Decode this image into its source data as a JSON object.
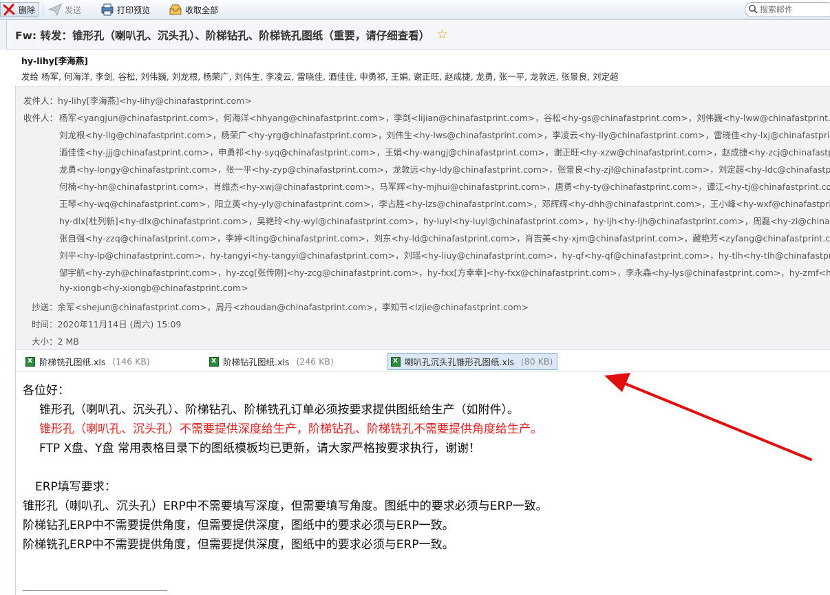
{
  "toolbar": {
    "delete_label": "删除",
    "send_label": "发送",
    "print_label": "打印预览",
    "receive_label": "收取全部",
    "search_placeholder": "搜索邮件"
  },
  "email": {
    "subject": "Fw: 转发：锥形孔（喇叭孔、沉头孔）、阶梯钻孔、阶梯铣孔图纸（重要，请仔细查看）",
    "from_name": "hy-lihy[李海燕]",
    "sendto_line": "发给 杨军, 何海洋, 李剑, 谷松, 刘伟巍, 刘龙根, 杨荣广, 刘伟生, 李凌云, 雷晓佳, 酒佳佳, 申勇祁, 王娟, 谢正旺, 赵成捷, 龙勇, 张一平, 龙敦远, 张景良, 刘定超",
    "sender_label": "发件人：",
    "sender_value": "hy-lihy[李海燕]<hy-lihy@chinafastprint.com>",
    "recipients_label": "收件人：",
    "recipients_lines": [
      "杨军<yangjun@chinafastprint.com>，何海洋<hhyang@chinafastprint.com>，李剑<lijian@chinafastprint.com>，谷松<hy-gs@chinafastprint.com>，刘伟巍<hy-lww@chinafastprint.co",
      "刘龙根<hy-llg@chinafastprint.com>，杨荣广<hy-yrg@chinafastprint.com>，刘伟生<hy-lws@chinafastprint.com>，李凌云<hy-lly@chinafastprint.com>，雷晓佳<hy-lxj@chinafastprint",
      "酒佳佳<hy-jjj@chinafastprint.com>，申勇祁<hy-syq@chinafastprint.com>，王娟<hy-wangj@chinafastprint.com>，谢正旺<hy-xzw@chinafastprint.com>，赵成捷<hy-zcj@chinafastpr",
      "龙勇<hy-longy@chinafastprint.com>，张一平<hy-zyp@chinafastprint.com>，龙敦远<hy-ldy@chinafastprint.com>，张景良<hy-zjl@chinafastprint.com>，刘定超<hy-ldc@chinafastpri",
      "何楠<hy-hn@chinafastprint.com>，肖维杰<hy-xwj@chinafastprint.com>，马军辉<hy-mjhui@chinafastprint.com>，唐勇<hy-ty@chinafastprint.com>，谭江<hy-tj@chinafastprint.con",
      "王琴<hy-wq@chinafastprint.com>，阳立英<hy-yly@chinafastprint.com>，李占胜<hy-lzs@chinafastprint.com>，邓辉辉<hy-dhh@chinafastprint.com>，王小峰<hy-wxf@chinafastprin",
      "hy-dlx[杜列新]<hy-dlx@chinafastprint.com>，吴艳玲<hy-wyl@chinafastprint.com>，hy-luyl<hy-luyl@chinafastprint.com>，hy-ljh<hy-ljh@chinafastprint.com>，周磊<hy-zl@chinafa",
      "张自强<hy-zzq@chinafastprint.com>，李婷<lting@chinafastprint.com>，刘东<hy-ld@chinafastprint.com>，肖吉美<hy-xjm@chinafastprint.com>，藏艳芳<zyfang@chinafastprint.cor",
      "刘平<hy-lp@chinafastprint.com>，hy-tangyi<hy-tangyi@chinafastprint.com>，刘瑶<hy-liuy@chinafastprint.com>，hy-qf<hy-qf@chinafastprint.com>，hy-tlh<hy-tlh@chinafastprin",
      "邹宇航<hy-zyh@chinafastprint.com>，hy-zcg[张传刚]<hy-zcg@chinafastprint.com>，hy-fxx[方幸幸]<hy-fxx@chinafastprint.com>，李永森<hy-lys@chinafastprint.com>，hy-zmf<hy",
      "hy-xiongb<hy-xiongb@chinafastprint.com>"
    ],
    "cc_label": "抄送：",
    "cc_value": "余军<shejun@chinafastprint.com>，周丹<zhoudan@chinafastprint.com>，李知节<lzjie@chinafastprint.com>",
    "time_label": "时间：",
    "time_value": "2020年11月14日 (周六) 15:09",
    "size_label": "大小：",
    "size_value": "2 MB"
  },
  "attachments": [
    {
      "name": "阶梯铣孔图纸.xls",
      "size": "(146 KB)"
    },
    {
      "name": "阶梯钻孔图纸.xls",
      "size": "(246 KB)"
    },
    {
      "name": "喇叭孔沉头孔锥形孔图纸.xls",
      "size": "(80 KB)"
    }
  ],
  "body": {
    "greeting": "各位好：",
    "line1": "锥形孔（喇叭孔、沉头孔）、阶梯钻孔、阶梯铣孔订单必须按要求提供图纸给生产（如附件）。",
    "line2_red": "锥形孔（喇叭孔、沉头孔）不需要提供深度给生产，阶梯钻孔、阶梯铣孔不需要提供角度给生产。",
    "line3": "FTP X盘、Y盘 常用表格目录下的图纸模板均已更新，请大家严格按要求执行，谢谢！",
    "erp_title": "ERP填写要求：",
    "erp1": "锥形孔（喇叭孔、沉头孔）ERP中不需要填写深度，但需要填写角度。图纸中的要求必须与ERP一致。",
    "erp2": "阶梯钻孔ERP中不需要提供角度，但需要提供深度，图纸中的要求必须与ERP一致。",
    "erp3": "阶梯铣孔ERP中不需要提供角度，但需要提供深度，图纸中的要求必须与ERP一致。"
  },
  "colors": {
    "red_text": "#e02020",
    "annotation_arrow": "#e01010",
    "star": "#e0a81c"
  }
}
